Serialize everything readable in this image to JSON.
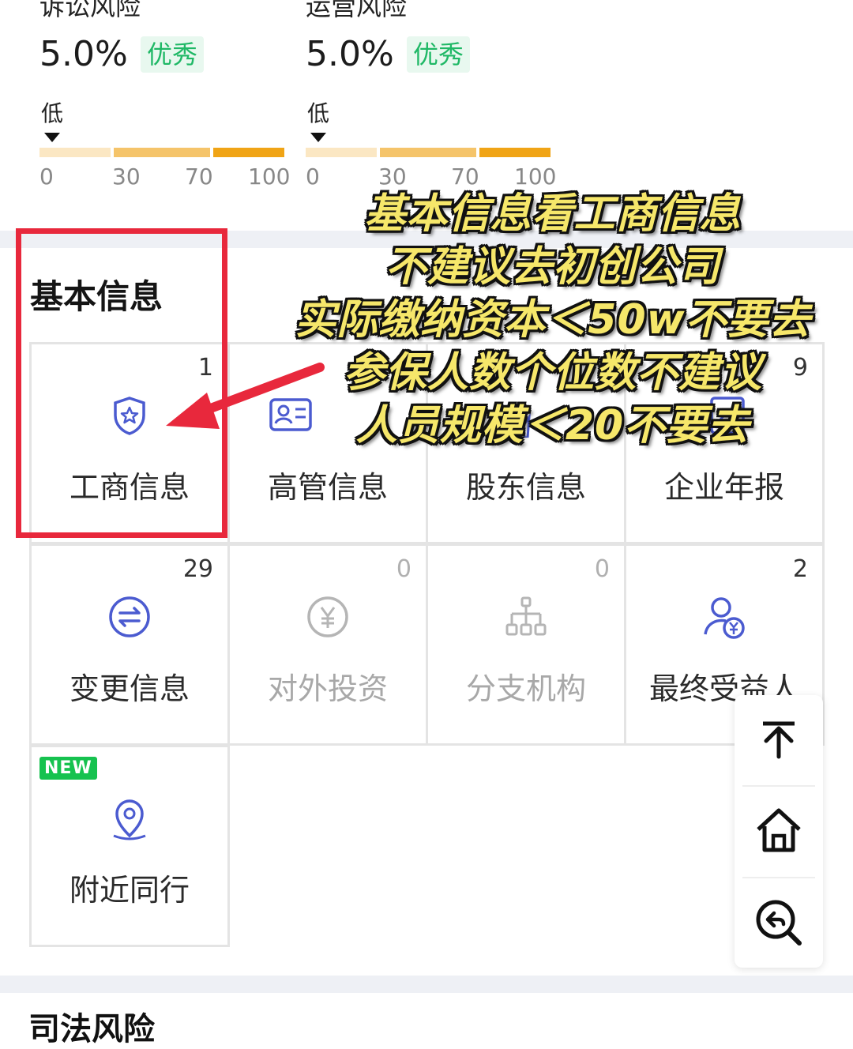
{
  "risks": [
    {
      "title": "诉讼风险",
      "value": "5.0%",
      "badge": "优秀",
      "level_label": "低",
      "ticks": [
        "0",
        "30",
        "70",
        "100"
      ]
    },
    {
      "title": "运营风险",
      "value": "5.0%",
      "badge": "优秀",
      "level_label": "低",
      "ticks": [
        "0",
        "30",
        "70",
        "100"
      ]
    }
  ],
  "colors": {
    "bar_low": "#fbe7c3",
    "bar_mid": "#f5c46a",
    "bar_high": "#f0a416",
    "badge_green": "#1fb866",
    "highlight_red": "#e8283c",
    "icon_blue": "#4b5bd0",
    "overlay_yellow": "#f6e76a"
  },
  "section": {
    "title": "基本信息"
  },
  "tiles": [
    {
      "label": "工商信息",
      "count": "1",
      "icon": "shield-star-icon"
    },
    {
      "label": "高管信息",
      "count": "",
      "icon": "id-card-icon"
    },
    {
      "label": "股东信息",
      "count": "",
      "icon": "tie-person-icon"
    },
    {
      "label": "企业年报",
      "count": "9",
      "icon": "report-chart-icon"
    },
    {
      "label": "变更信息",
      "count": "29",
      "icon": "exchange-icon"
    },
    {
      "label": "对外投资",
      "count": "0",
      "icon": "yen-circle-icon"
    },
    {
      "label": "分支机构",
      "count": "0",
      "icon": "org-tree-icon"
    },
    {
      "label": "最终受益人",
      "count": "2",
      "icon": "person-yen-icon"
    },
    {
      "label": "附近同行",
      "badge": "NEW",
      "icon": "location-pin-icon"
    }
  ],
  "overlay_lines": [
    "基本信息看工商信息",
    "不建议去初创公司",
    "实际缴纳资本＜50w不要去",
    "参保人数个位数不建议",
    "人员规模＜20不要去"
  ],
  "float_buttons": [
    "back-to-top-icon",
    "home-icon",
    "search-back-icon"
  ],
  "next_section_peek": "司法风险"
}
